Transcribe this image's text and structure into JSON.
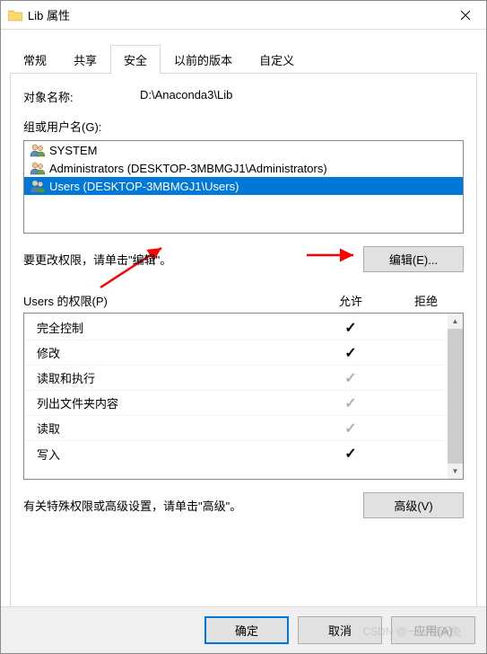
{
  "window": {
    "title": "Lib 属性"
  },
  "tabs": {
    "t0": "常规",
    "t1": "共享",
    "t2": "安全",
    "t3": "以前的版本",
    "t4": "自定义"
  },
  "object": {
    "label": "对象名称:",
    "path": "D:\\Anaconda3\\Lib"
  },
  "groups": {
    "label": "组或用户名(G):",
    "items": {
      "i0": "SYSTEM",
      "i1": "Administrators (DESKTOP-3MBMGJ1\\Administrators)",
      "i2": "Users (DESKTOP-3MBMGJ1\\Users)"
    }
  },
  "edit": {
    "hint": "要更改权限，请单击\"编辑\"。",
    "button": "编辑(E)..."
  },
  "perms": {
    "title": "Users 的权限(P)",
    "allow": "允许",
    "deny": "拒绝",
    "rows": {
      "r0": "完全控制",
      "r1": "修改",
      "r2": "读取和执行",
      "r3": "列出文件夹内容",
      "r4": "读取",
      "r5": "写入"
    }
  },
  "advanced": {
    "hint": "有关特殊权限或高级设置，请单击\"高级\"。",
    "button": "高级(V)"
  },
  "footer": {
    "ok": "确定",
    "cancel": "取消",
    "apply": "应用(A)"
  },
  "watermark": "CSDN @一只萌新兔"
}
